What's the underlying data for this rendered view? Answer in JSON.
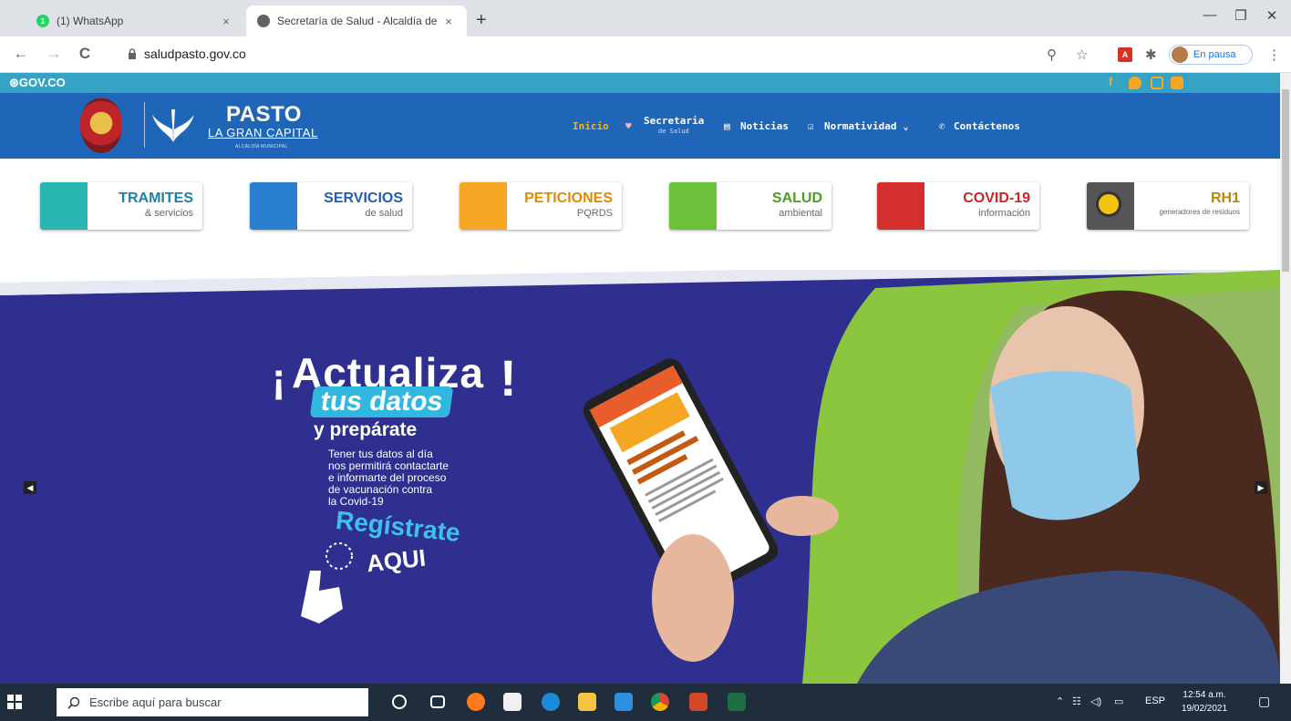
{
  "browser": {
    "tabs": [
      {
        "title": "(1) WhatsApp",
        "icon": "whatsapp-icon",
        "badge": "1",
        "close": "×"
      },
      {
        "title": "Secretaría de Salud - Alcaldía de",
        "icon": "globe-icon",
        "close": "×"
      }
    ],
    "new_tab": "+",
    "window_controls": {
      "minimize": "—",
      "maximize": "❐",
      "close": "✕"
    },
    "nav": {
      "back": "←",
      "forward": "→",
      "reload": "C"
    },
    "url": "saludpasto.gov.co",
    "profile_status": "En pausa",
    "menu": "⋮"
  },
  "govbar": {
    "logo": "GOV.CO",
    "social_colors": {
      "facebook": "#f5a623",
      "twitter": "#f5a623",
      "instagram": "#f5a623",
      "youtube": "#f5a623"
    }
  },
  "header": {
    "brand_title": "PASTO",
    "brand_subtitle": "LA GRAN CAPITAL",
    "brand_caption": "ALCALDÍA MUNICIPAL",
    "nav": [
      {
        "label": "Inicio",
        "active": true
      },
      {
        "label": "Secretaria",
        "sub": "de Salud",
        "icon": "heart-icon"
      },
      {
        "label": "Noticias",
        "icon": "newspaper-icon"
      },
      {
        "label": "Normatividad ⌄",
        "icon": "document-icon"
      },
      {
        "label": "Contáctenos",
        "icon": "phone-icon"
      }
    ]
  },
  "tiles": [
    {
      "title": "TRAMITES",
      "subtitle": "& servicios",
      "color": "#29b6b0",
      "text_color": "#1f7fa8"
    },
    {
      "title": "SERVICIOS",
      "subtitle": "de salud",
      "color": "#2b7fd0",
      "text_color": "#1f5fb0"
    },
    {
      "title": "PETICIONES",
      "subtitle": "PQRDS",
      "color": "#f5a623",
      "text_color": "#e08a00"
    },
    {
      "title": "SALUD",
      "subtitle": "ambiental",
      "color": "#6cc03a",
      "text_color": "#4a9e20"
    },
    {
      "title": "COVID-19",
      "subtitle": "información",
      "color": "#d32f2f",
      "text_color": "#c62828"
    },
    {
      "title": "RH1",
      "subtitle": "generadores de residuos",
      "color": "#555555",
      "text_color": "#b8860b"
    }
  ],
  "banner": {
    "headline": "Actualiza",
    "headline_open": "¡",
    "headline_close": "!",
    "highlight": "tus datos",
    "subheadline": "y prepárate",
    "description": "Tener tus datos al día\nnos permitirá contactarte\ne informarte del proceso\nde vacunación contra\nla Covid-19",
    "cta1": "Regístrate",
    "cta2": "AQUI",
    "prev": "◀",
    "next": "▶",
    "colors": {
      "bg": "#2e2f8e",
      "green": "#8cc63f",
      "accent": "#32b8e0"
    }
  },
  "taskbar": {
    "search_placeholder": "Escribe aquí para buscar",
    "language": "ESP",
    "time": "12:54 a.m.",
    "date": "19/02/2021"
  }
}
